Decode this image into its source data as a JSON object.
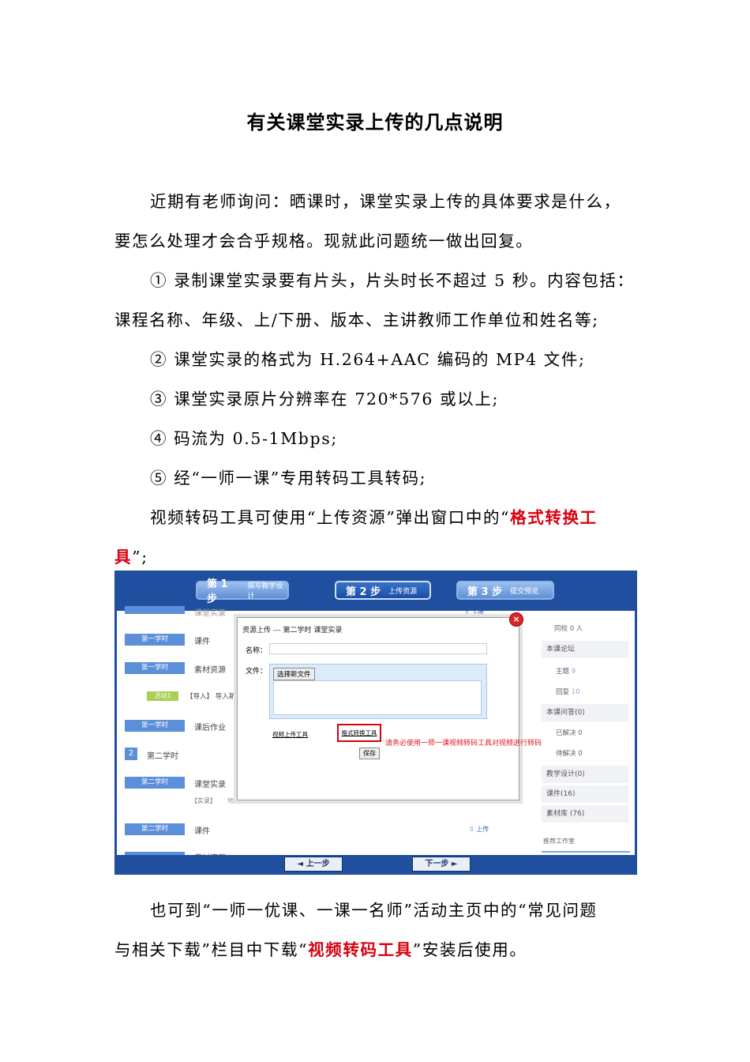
{
  "title": "有关课堂实录上传的几点说明",
  "paragraphs": {
    "p1_line1": "近期有老师询问：晒课时，课堂实录上传的具体要求是什么，",
    "p1_line2": "要怎么处理才会合乎规格。现就此问题统一做出回复。",
    "item1_line1": "① 录制课堂实录要有片头，片头时长不超过 5 秒。内容包括：",
    "item1_line2": "课程名称、年级、上/下册、版本、主讲教师工作单位和姓名等;",
    "item2": "② 课堂实录的格式为 H.264+AAC 编码的 MP4 文件;",
    "item3": "③ 课堂实录原片分辨率在 720*576 或以上;",
    "item4": "④ 码流为 0.5-1Mbps;",
    "item5": "⑤ 经“一师一课”专用转码工具转码;",
    "tool_line1_pre": "视频转码工具可使用“上传资源”弹出窗口中的“",
    "tool_line1_red": "格式转换工",
    "tool_line2_red": "具",
    "tool_line2_post": "”;",
    "tail_line1": "也可到“一师一优课、一课一名师”活动主页中的“常见问题",
    "tail_line2_pre": "与相关下载”栏目中下载“",
    "tail_line2_red": "视频转码工具",
    "tail_line2_post": "”安装后使用。"
  },
  "screenshot": {
    "steps": [
      {
        "num": "第 1 步",
        "label": "撰写教学设计"
      },
      {
        "num": "第 2 步",
        "label": "上传资源"
      },
      {
        "num": "第 3 步",
        "label": "提交预览"
      }
    ],
    "left_items": {
      "top_partial": "课堂实录",
      "item1_tag": "第一学时",
      "item1_text": "课件",
      "item2_tag": "第一学时",
      "item2_text": "素材资源",
      "activity_tag": "活动1",
      "activity_text": "【导入】 导入新",
      "item3_tag": "第一学时",
      "item3_text": "课后作业",
      "section_num": "2",
      "section_text": "第二学时",
      "item4_tag": "第二学时",
      "item4_text": "课堂实录",
      "shilu_text": "【实录】",
      "shilu_place": "地方",
      "item5_tag": "第二学时",
      "item5_text": "课件",
      "bottom_partial": "素材资源"
    },
    "upload_top": "⇧ 上传",
    "upload_bottom": "⇧ 上传",
    "right": {
      "same_school": "同校 0 人",
      "forum": "本课论坛",
      "topic": "主题",
      "topic_n": "9",
      "reply": "回复",
      "reply_n": "10",
      "qa": "本课问答(0)",
      "solved": "已解决 0",
      "unsolved": "待解决 0",
      "design": "教学设计(0)",
      "courseware": "课件(16)",
      "material": "素材库 (76)",
      "studio": "推荐工作室"
    },
    "dialog": {
      "title": "资源上传 --- 第二学时 课堂实录",
      "name_label": "名称：",
      "file_label": "文件：",
      "choose_btn": "选择新文件",
      "video_tool": "视频上传工具",
      "format_tool": "格式转换工具",
      "hint": "请务必使用一师一课视频转码工具对视频进行转码",
      "save": "保存",
      "close": "×"
    },
    "nav": {
      "prev": "◄ 上一步",
      "next": "下一步 ►"
    }
  }
}
